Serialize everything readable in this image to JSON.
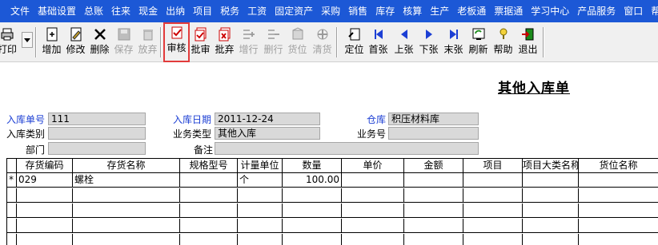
{
  "menubar": {
    "items": [
      "文件",
      "基础设置",
      "总账",
      "往来",
      "现金",
      "出纳",
      "项目",
      "税务",
      "工资",
      "固定资产",
      "采购",
      "销售",
      "库存",
      "核算",
      "生产",
      "老板通",
      "票据通",
      "学习中心",
      "产品服务",
      "窗口",
      "帮助"
    ]
  },
  "toolbar": {
    "print_label": "打印",
    "buttons": [
      {
        "label": "增加",
        "icon": "add-doc-icon",
        "enabled": true
      },
      {
        "label": "修改",
        "icon": "edit-doc-icon",
        "enabled": true
      },
      {
        "label": "删除",
        "icon": "delete-x-icon",
        "enabled": true
      },
      {
        "label": "保存",
        "icon": "save-disk-icon",
        "enabled": false
      },
      {
        "label": "放弃",
        "icon": "discard-trash-icon",
        "enabled": false
      },
      {
        "label": "审核",
        "icon": "audit-check-icon",
        "enabled": true,
        "highlighted": true
      },
      {
        "label": "批审",
        "icon": "batch-audit-icon",
        "enabled": true
      },
      {
        "label": "批弃",
        "icon": "batch-discard-icon",
        "enabled": true
      },
      {
        "label": "增行",
        "icon": "add-row-icon",
        "enabled": false
      },
      {
        "label": "删行",
        "icon": "delete-row-icon",
        "enabled": false
      },
      {
        "label": "货位",
        "icon": "location-icon",
        "enabled": false
      },
      {
        "label": "清货",
        "icon": "clear-goods-icon",
        "enabled": false
      },
      {
        "label": "定位",
        "icon": "locate-icon",
        "enabled": true
      },
      {
        "label": "首张",
        "icon": "first-icon",
        "enabled": true
      },
      {
        "label": "上张",
        "icon": "previous-icon",
        "enabled": true
      },
      {
        "label": "下张",
        "icon": "next-icon",
        "enabled": true
      },
      {
        "label": "末张",
        "icon": "last-icon",
        "enabled": true
      },
      {
        "label": "刷新",
        "icon": "refresh-icon",
        "enabled": true
      },
      {
        "label": "帮助",
        "icon": "help-icon",
        "enabled": true
      },
      {
        "label": "退出",
        "icon": "exit-icon",
        "enabled": true
      }
    ]
  },
  "form": {
    "title": "其他入库单",
    "fields": {
      "receipt_no": {
        "label": "入库单号",
        "value": "111"
      },
      "receipt_date": {
        "label": "入库日期",
        "value": "2011-12-24"
      },
      "warehouse": {
        "label": "仓库",
        "value": "积压材料库"
      },
      "receipt_type": {
        "label": "入库类别",
        "value": ""
      },
      "business_type": {
        "label": "业务类型",
        "value": "其他入库"
      },
      "business_no": {
        "label": "业务号",
        "value": ""
      },
      "department": {
        "label": "部门",
        "value": ""
      },
      "remark": {
        "label": "备注",
        "value": ""
      }
    }
  },
  "grid": {
    "columns": [
      "存货编码",
      "存货名称",
      "规格型号",
      "计量单位",
      "数量",
      "单价",
      "金额",
      "项目",
      "项目大类名称",
      "货位名称"
    ],
    "rows": [
      {
        "marker": "*",
        "cells": [
          "029",
          "螺栓",
          "",
          "个",
          "100.00",
          "",
          "",
          "",
          "",
          ""
        ]
      }
    ]
  },
  "colors": {
    "menubar_bg": "#1c58d6",
    "label_blue": "#1c3fd4",
    "highlight_red": "#e23b3b",
    "field_bg": "#d9d9d9"
  }
}
